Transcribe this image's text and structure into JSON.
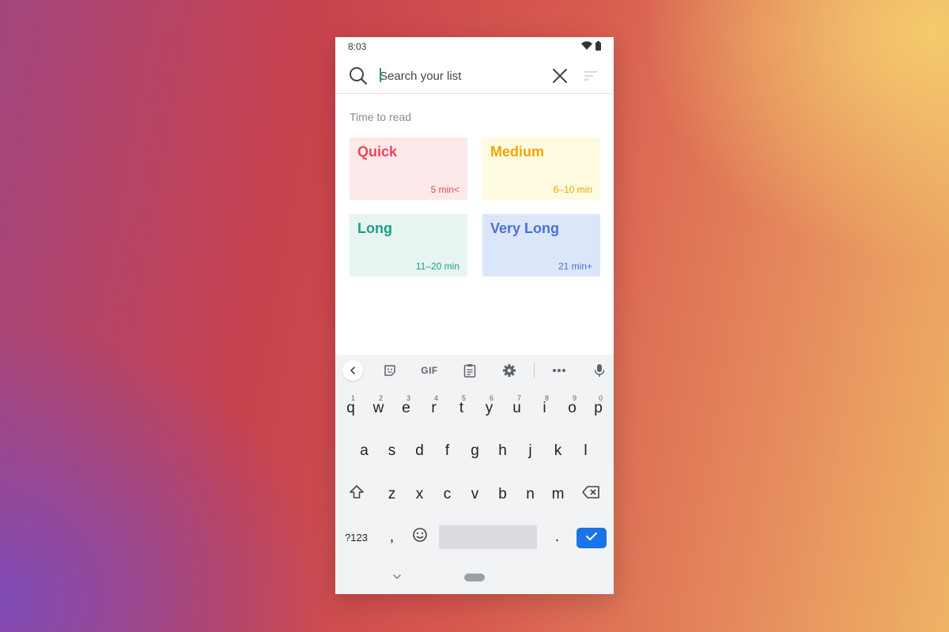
{
  "status_bar": {
    "time": "8:03",
    "wifi_icon": "wifi-icon",
    "battery_icon": "battery-icon"
  },
  "search": {
    "placeholder": "Search your list",
    "value": ""
  },
  "section": {
    "title": "Time to read"
  },
  "cards": {
    "quick": {
      "title": "Quick",
      "time": "5 min<",
      "color": "#e8475d",
      "bg": "#fde8ea"
    },
    "medium": {
      "title": "Medium",
      "time": "6–10 min",
      "color": "#f0a500",
      "bg": "#fffbe0"
    },
    "long": {
      "title": "Long",
      "time": "11–20 min",
      "color": "#1a9e8a",
      "bg": "#e6f4f2"
    },
    "very_long": {
      "title": "Very Long",
      "time": "21 min+",
      "color": "#4a6fd8",
      "bg": "#dbe6fb"
    }
  },
  "keyboard": {
    "toolbar": {
      "gif_label": "GIF"
    },
    "row1": [
      "q",
      "w",
      "e",
      "r",
      "t",
      "y",
      "u",
      "i",
      "o",
      "p"
    ],
    "row1_hints": [
      "1",
      "2",
      "3",
      "4",
      "5",
      "6",
      "7",
      "8",
      "9",
      "0"
    ],
    "row2": [
      "a",
      "s",
      "d",
      "f",
      "g",
      "h",
      "j",
      "k",
      "l"
    ],
    "row3": [
      "z",
      "x",
      "c",
      "v",
      "b",
      "n",
      "m"
    ],
    "bottom": {
      "symbols": "?123",
      "comma": ",",
      "period": "."
    }
  }
}
